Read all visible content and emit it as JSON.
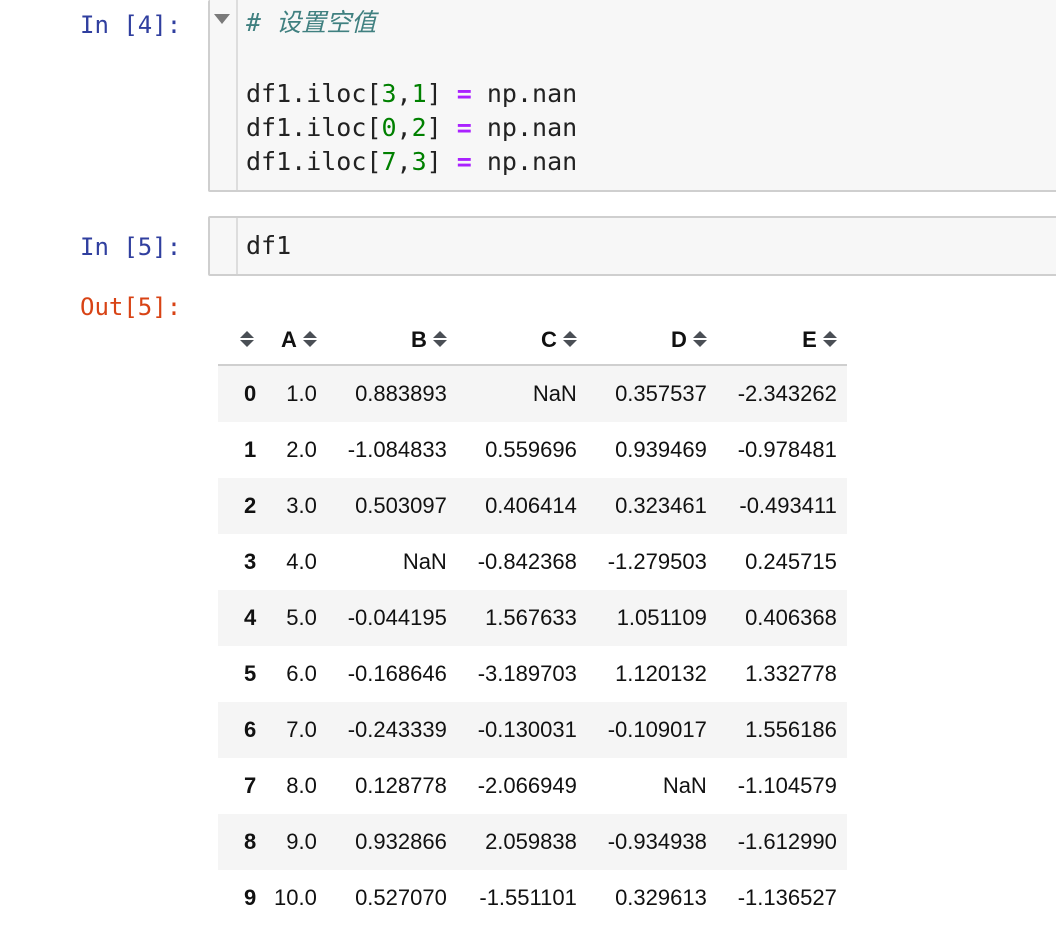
{
  "cells": [
    {
      "prompt": "In [4]:",
      "comment": "# 设置空值",
      "lines": [
        {
          "obj": "df1.iloc[",
          "a": "3",
          "sep": ",",
          "b": "1",
          "close": "] ",
          "op": "=",
          "rest": " np.nan"
        },
        {
          "obj": "df1.iloc[",
          "a": "0",
          "sep": ",",
          "b": "2",
          "close": "] ",
          "op": "=",
          "rest": " np.nan"
        },
        {
          "obj": "df1.iloc[",
          "a": "7",
          "sep": ",",
          "b": "3",
          "close": "] ",
          "op": "=",
          "rest": " np.nan"
        }
      ]
    },
    {
      "prompt": "In [5]:",
      "code": "df1"
    }
  ],
  "output": {
    "prompt": "Out[5]:",
    "table": {
      "columns": [
        "A",
        "B",
        "C",
        "D",
        "E"
      ],
      "rows": [
        {
          "index": "0",
          "cells": [
            "1.0",
            "0.883893",
            "NaN",
            "0.357537",
            "-2.343262"
          ]
        },
        {
          "index": "1",
          "cells": [
            "2.0",
            "-1.084833",
            "0.559696",
            "0.939469",
            "-0.978481"
          ]
        },
        {
          "index": "2",
          "cells": [
            "3.0",
            "0.503097",
            "0.406414",
            "0.323461",
            "-0.493411"
          ]
        },
        {
          "index": "3",
          "cells": [
            "4.0",
            "NaN",
            "-0.842368",
            "-1.279503",
            "0.245715"
          ]
        },
        {
          "index": "4",
          "cells": [
            "5.0",
            "-0.044195",
            "1.567633",
            "1.051109",
            "0.406368"
          ]
        },
        {
          "index": "5",
          "cells": [
            "6.0",
            "-0.168646",
            "-3.189703",
            "1.120132",
            "1.332778"
          ]
        },
        {
          "index": "6",
          "cells": [
            "7.0",
            "-0.243339",
            "-0.130031",
            "-0.109017",
            "1.556186"
          ]
        },
        {
          "index": "7",
          "cells": [
            "8.0",
            "0.128778",
            "-2.066949",
            "NaN",
            "-1.104579"
          ]
        },
        {
          "index": "8",
          "cells": [
            "9.0",
            "0.932866",
            "2.059838",
            "-0.934938",
            "-1.612990"
          ]
        },
        {
          "index": "9",
          "cells": [
            "10.0",
            "0.527070",
            "-1.551101",
            "0.329613",
            "-1.136527"
          ]
        }
      ]
    }
  },
  "colors": {
    "in_prompt": "#303f9f",
    "out_prompt": "#d84315",
    "comment": "#408080",
    "number": "#008000",
    "operator": "#aa22ff"
  },
  "icons": [
    "collapse-caret-icon",
    "sort-icon"
  ]
}
